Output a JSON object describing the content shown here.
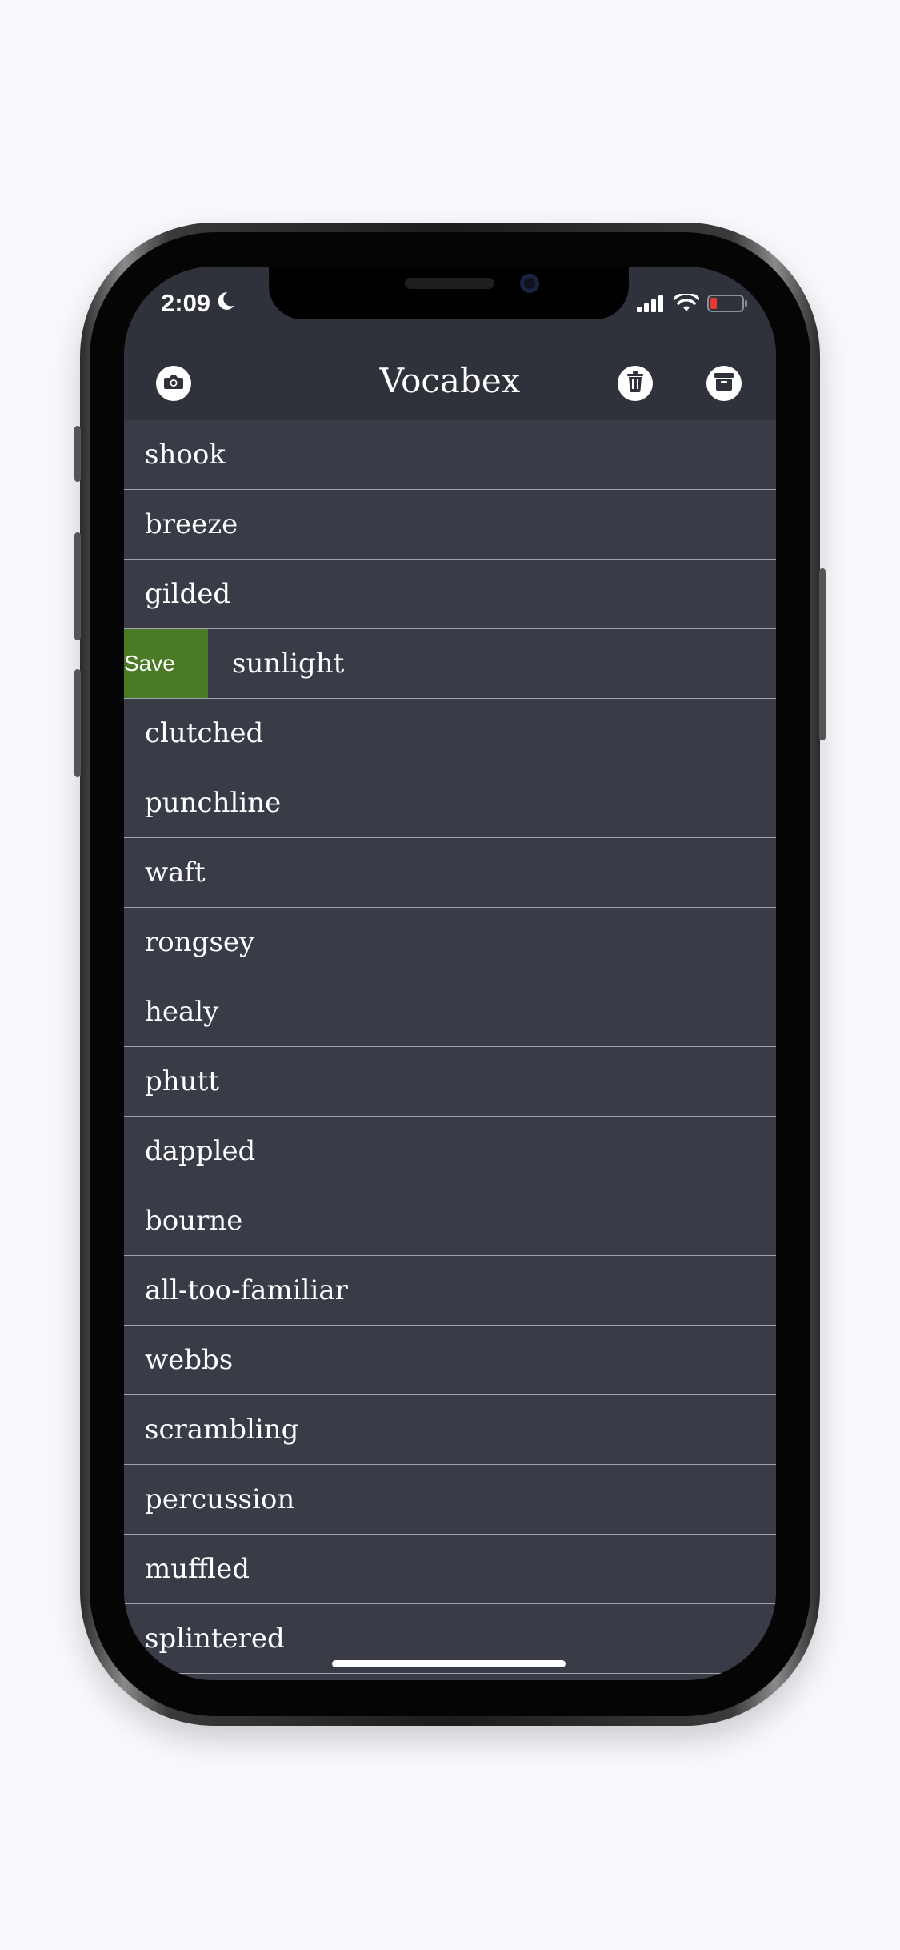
{
  "status_bar": {
    "time": "2:09"
  },
  "app": {
    "title": "Vocabex"
  },
  "colors": {
    "background": "#393c46",
    "header": "#2f323a",
    "save_action": "#4a7a26",
    "battery_low": "#e53935"
  },
  "icons": {
    "camera": "camera-icon",
    "delete": "trash-icon",
    "archive": "archive-icon"
  },
  "list": {
    "swipe_action_label": "Save",
    "words": [
      "shook",
      "breeze",
      "gilded",
      "sunlight",
      "clutched",
      "punchline",
      "waft",
      "rongsey",
      "healy",
      "phutt",
      "dappled",
      "bourne",
      "all-too-familiar",
      "webbs",
      "scrambling",
      "percussion",
      "muffled",
      "splintered"
    ]
  }
}
